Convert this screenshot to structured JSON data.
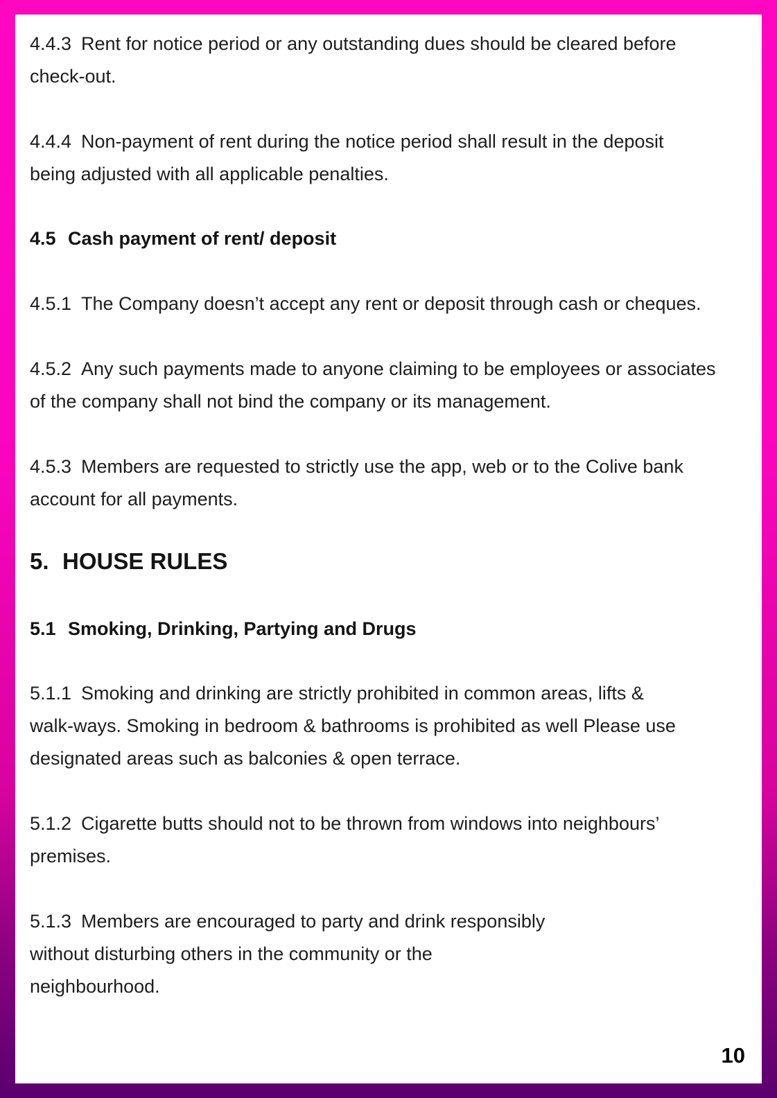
{
  "document": {
    "paragraphs_top": [
      {
        "number": "4.4.3",
        "lines": [
          "Rent for notice period or any outstanding dues should be cleared before",
          "check-out."
        ]
      },
      {
        "number": "4.4.4",
        "lines": [
          "Non-payment of rent during the notice period shall result in the deposit",
          "being adjusted with all applicable penalties."
        ]
      }
    ],
    "subsection_4_5": {
      "number": "4.5",
      "title": "Cash payment of rent/ deposit"
    },
    "paragraphs_4_5": [
      {
        "number": "4.5.1",
        "lines": [
          "The Company doesn’t accept any rent or deposit through cash or cheques."
        ]
      },
      {
        "number": "4.5.2",
        "lines": [
          "Any such payments made to anyone claiming to be employees or associates",
          "of the company shall not bind the company or its management."
        ]
      },
      {
        "number": "4.5.3",
        "lines": [
          "Members are requested to strictly use the app, web or to the Colive bank",
          "account for all payments."
        ]
      }
    ],
    "section_5": {
      "number": "5.",
      "title": "HOUSE RULES"
    },
    "subsection_5_1": {
      "number": "5.1",
      "title": "Smoking, Drinking, Partying and Drugs"
    },
    "paragraphs_5_1": [
      {
        "number": "5.1.1",
        "lines": [
          "Smoking and drinking are strictly prohibited in common areas, lifts &",
          "walk-ways. Smoking in bedroom &  bathrooms is prohibited as well Please use",
          "designated areas such as balconies & open terrace."
        ]
      },
      {
        "number": "5.1.2",
        "lines": [
          "Cigarette butts should not to be thrown from windows into neighbours’",
          "premises."
        ]
      },
      {
        "number": "5.1.3",
        "lines": [
          "Members are encouraged to party and drink responsibly",
          "without disturbing others in the community or the",
          "neighbourhood."
        ]
      }
    ],
    "page_number": "10"
  },
  "colors": {
    "border_top": "#ff06c1",
    "border_bottom": "#5a006f",
    "text": "#1d1d1d",
    "background": "#ffffff"
  }
}
